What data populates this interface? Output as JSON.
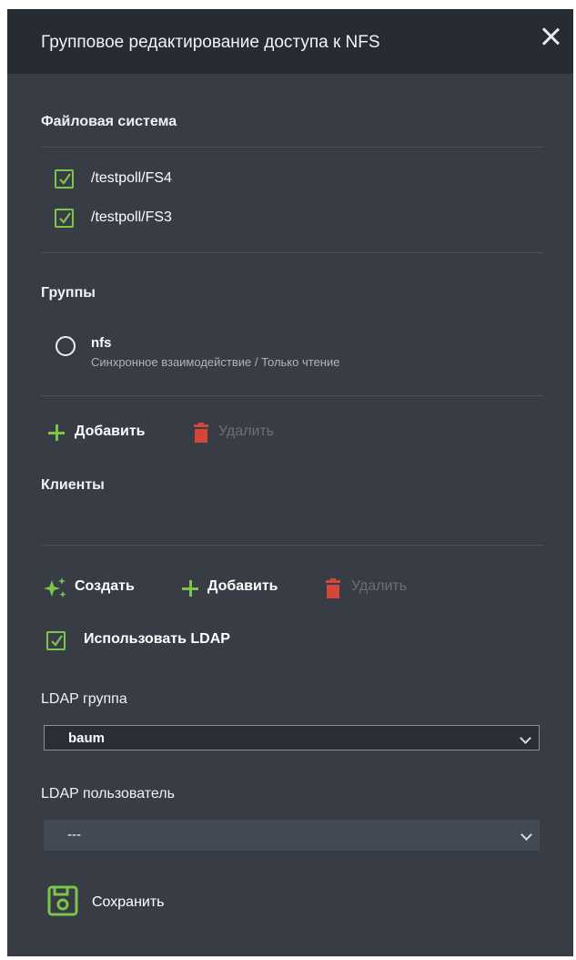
{
  "dialog": {
    "title": "Групповое редактирование доступа к NFS",
    "close_label": "×"
  },
  "filesystems": {
    "label": "Файловая система",
    "items": [
      {
        "path": "/testpoll/FS4",
        "checked": true
      },
      {
        "path": "/testpoll/FS3",
        "checked": true
      }
    ]
  },
  "groups": {
    "label": "Группы",
    "items": [
      {
        "name": "nfs",
        "description": "Синхронное взаимодействие / Только чтение",
        "selected": false
      }
    ],
    "add_label": "Добавить",
    "delete_label": "Удалить"
  },
  "clients": {
    "label": "Клиенты",
    "create_label": "Создать",
    "add_label": "Добавить",
    "delete_label": "Удалить"
  },
  "ldap": {
    "use_ldap_label": "Использовать LDAP",
    "use_ldap_checked": true,
    "group_label": "LDAP группа",
    "group_value": "baum",
    "user_label": "LDAP пользователь",
    "user_value": "---"
  },
  "save_label": "Сохранить",
  "colors": {
    "panel": "#373c45",
    "header": "#272b33",
    "accent_green": "#7cc54b",
    "danger_red": "#d44639"
  },
  "icons": [
    "close-icon",
    "checkbox-icon",
    "radio-icon",
    "plus-icon",
    "trash-icon",
    "sparkle-icon",
    "chevron-down-icon",
    "save-icon"
  ]
}
